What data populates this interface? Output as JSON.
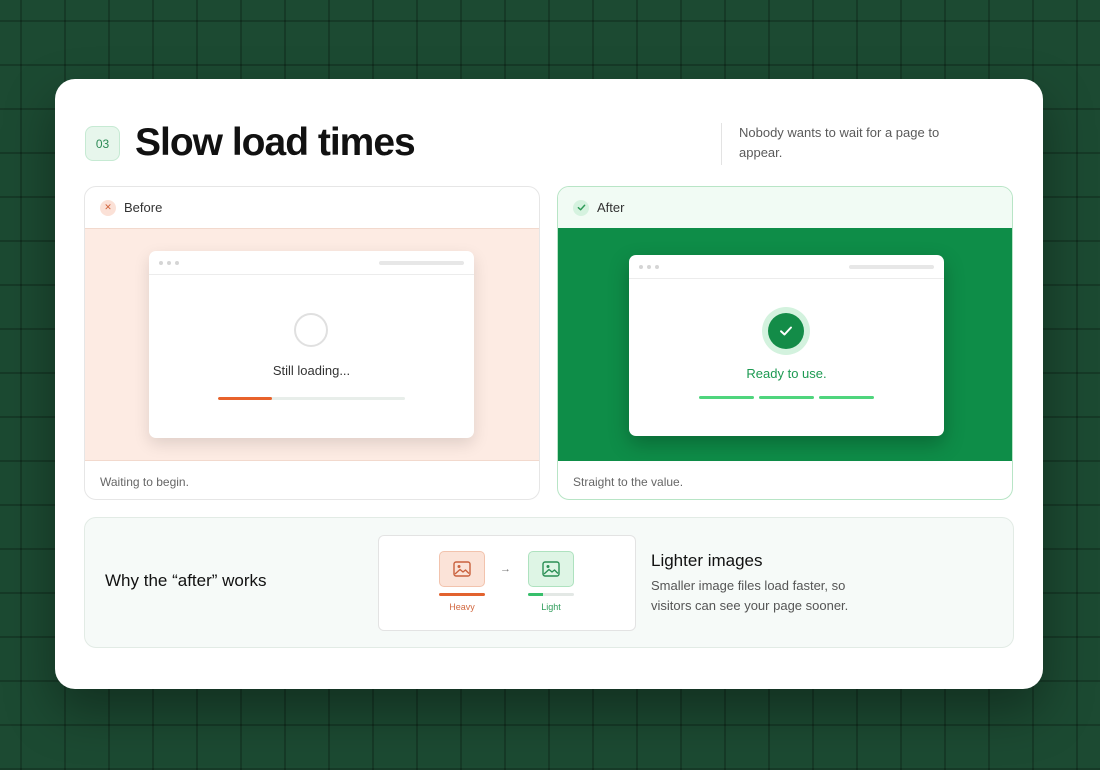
{
  "header": {
    "step_number": "03",
    "title": "Slow load times",
    "subtitle": "Nobody wants to wait for a page to appear."
  },
  "before": {
    "label": "Before",
    "status_icon": "x-icon",
    "status_color": "#d0623a",
    "loading_text": "Still loading...",
    "progress_fraction": 0.29,
    "progress_color": "#e8622b",
    "caption": "Waiting to begin."
  },
  "after": {
    "label": "After",
    "status_icon": "check-icon",
    "status_color": "#2d9a57",
    "background_color": "#0e8d48",
    "ready_text": "Ready to use.",
    "caption": "Straight to the value."
  },
  "explanation": {
    "heading": "Why the “after” works",
    "heavy_label": "Heavy",
    "light_label": "Light",
    "light_fraction": 0.32,
    "feature_title": "Lighter images",
    "feature_description": "Smaller image files load faster, so visitors can see your page sooner."
  }
}
